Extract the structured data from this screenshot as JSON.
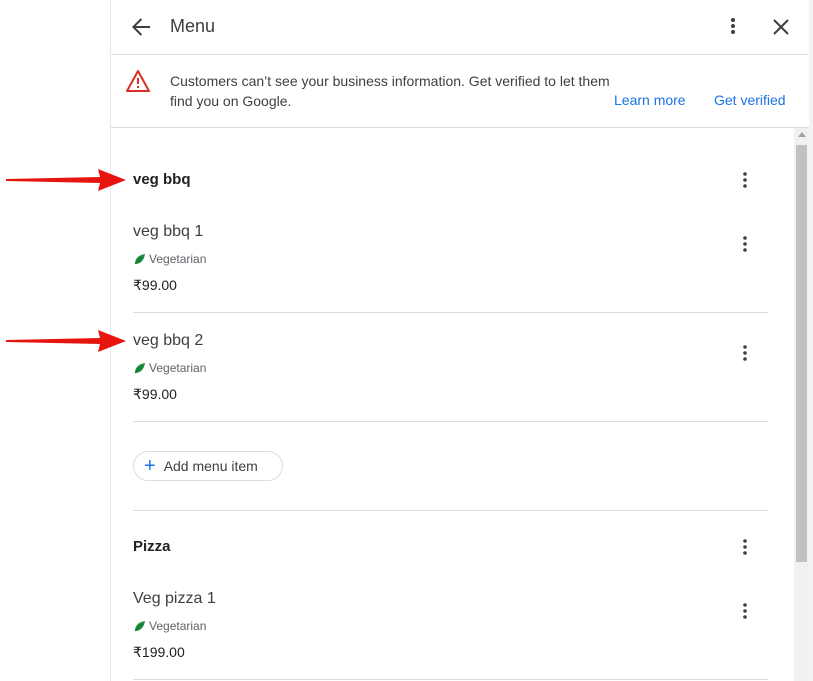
{
  "header": {
    "title": "Menu"
  },
  "banner": {
    "message": "Customers can’t see your business information. Get verified to let them find you on Google.",
    "learn_more": "Learn more",
    "get_verified": "Get verified"
  },
  "sections": [
    {
      "title": "veg bbq",
      "items": [
        {
          "name": "veg bbq 1",
          "tag": "Vegetarian",
          "price": "₹99.00"
        },
        {
          "name": "veg bbq 2",
          "tag": "Vegetarian",
          "price": "₹99.00"
        }
      ],
      "add_label": "Add menu item"
    },
    {
      "title": "Pizza",
      "items": [
        {
          "name": "Veg pizza 1",
          "tag": "Vegetarian",
          "price": "₹199.00"
        }
      ]
    }
  ],
  "colors": {
    "accent": "#1a73e8",
    "warning": "#d93025",
    "annotation_arrow": "#e8140f",
    "veg_leaf": "#1e8e3e"
  },
  "icons": [
    "back-arrow-icon",
    "more-vert-icon",
    "close-icon",
    "warning-icon",
    "leaf-icon",
    "plus-icon"
  ]
}
